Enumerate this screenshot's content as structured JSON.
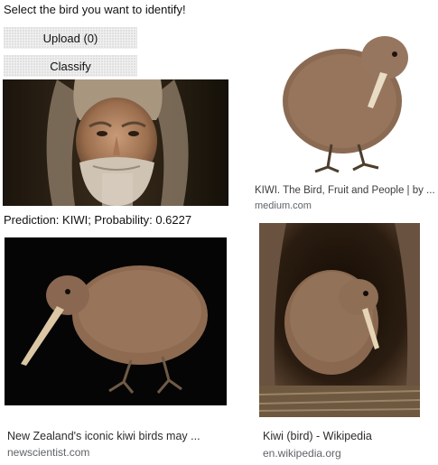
{
  "app": {
    "title": "Select the bird you want to identify!",
    "upload_label": "Upload (0)",
    "classify_label": "Classify",
    "prediction_text": "Prediction: KIWI; Probability: 0.6227"
  },
  "results": [
    {
      "title": "KIWI. The Bird, Fruit and People | by ...",
      "source": "medium.com"
    },
    {
      "title": "New Zealand's iconic kiwi birds may ...",
      "source": "newscientist.com"
    },
    {
      "title": "Kiwi (bird) - Wikipedia",
      "source": "en.wikipedia.org"
    }
  ]
}
